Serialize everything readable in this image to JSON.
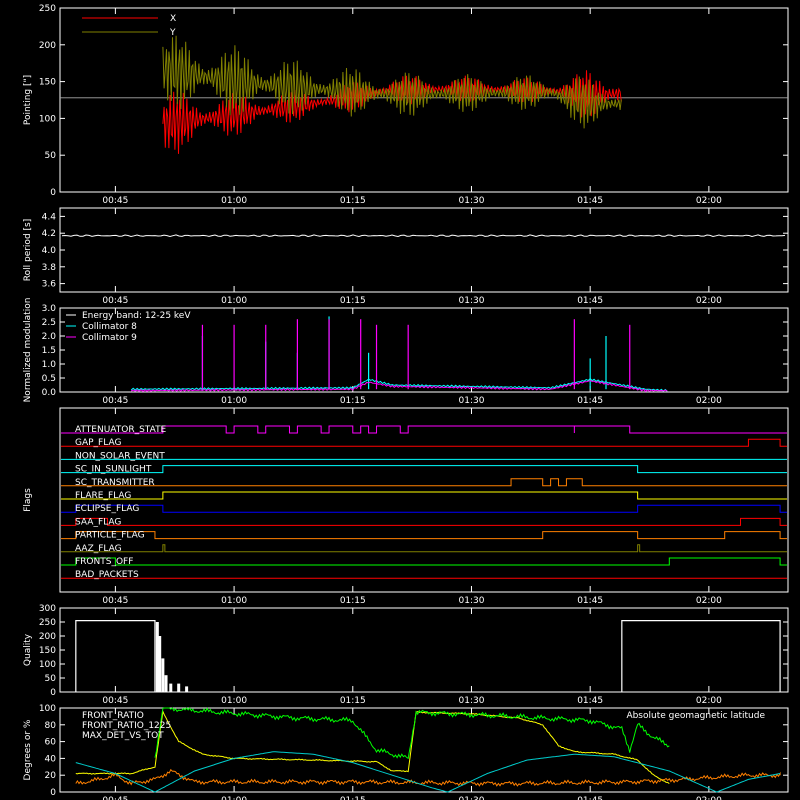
{
  "chart_data": [
    {
      "type": "line",
      "ylabel": "Pointing [\"]",
      "ylim": [
        0,
        250
      ],
      "yticks": [
        "0",
        "50",
        "100",
        "150",
        "200",
        "250"
      ],
      "xticks": [
        "00:45",
        "01:00",
        "01:15",
        "01:30",
        "01:45",
        "02:00"
      ],
      "series": [
        {
          "name": "X",
          "color": "#ff0000"
        },
        {
          "name": "Y",
          "color": "#808000"
        }
      ],
      "reference_level": 128,
      "data_window": [
        "00:51",
        "01:49"
      ],
      "oscillation_period_s": 4.2,
      "envelope": {
        "t": [
          "00:51",
          "01:00",
          "01:10",
          "01:20",
          "01:30",
          "01:40",
          "01:42",
          "01:45",
          "01:49"
        ],
        "x_min": [
          45,
          75,
          100,
          118,
          122,
          120,
          112,
          95,
          100
        ],
        "x_max": [
          140,
          135,
          140,
          160,
          158,
          155,
          160,
          168,
          168
        ],
        "y_min": [
          115,
          100,
          105,
          100,
          108,
          112,
          90,
          85,
          95
        ],
        "y_max": [
          218,
          200,
          175,
          165,
          160,
          160,
          165,
          155,
          145
        ]
      }
    },
    {
      "type": "line",
      "ylabel": "Roll period [s]",
      "ylim": [
        3.5,
        4.5
      ],
      "yticks": [
        "3.6",
        "3.8",
        "4.0",
        "4.2",
        "4.4"
      ],
      "xticks": [
        "00:45",
        "01:00",
        "01:15",
        "01:30",
        "01:45",
        "02:00"
      ],
      "series": [
        {
          "name": "",
          "color": "#ffffff",
          "value": 4.17
        }
      ]
    },
    {
      "type": "line",
      "ylabel": "Normalized modulation",
      "ylim": [
        0,
        3
      ],
      "yticks": [
        "0.0",
        "0.5",
        "1.0",
        "1.5",
        "2.0",
        "2.5",
        "3.0"
      ],
      "xticks": [
        "00:45",
        "01:00",
        "01:15",
        "01:30",
        "01:45",
        "02:00"
      ],
      "legend": [
        "Energy band: 12-25 keV",
        "Collimator 8",
        "Collimator 9"
      ],
      "series": [
        {
          "name": "Collimator 8",
          "color": "#00ffff",
          "baseline": [
            [
              "00:47",
              0.1
            ],
            [
              "01:15",
              0.15
            ],
            [
              "01:17",
              0.45
            ],
            [
              "01:20",
              0.25
            ],
            [
              "01:30",
              0.2
            ],
            [
              "01:40",
              0.15
            ],
            [
              "01:45",
              0.45
            ],
            [
              "01:52",
              0.1
            ],
            [
              "01:55",
              0.05
            ]
          ],
          "spikes": [
            [
              "00:56",
              2.0
            ],
            [
              "01:04",
              1.8
            ],
            [
              "01:08",
              1.4
            ],
            [
              "01:12",
              2.7
            ],
            [
              "01:17",
              1.4
            ],
            [
              "01:45",
              1.2
            ],
            [
              "01:47",
              2.0
            ]
          ]
        },
        {
          "name": "Collimator 9",
          "color": "#ff00ff",
          "baseline": [
            [
              "00:47",
              0.05
            ],
            [
              "01:15",
              0.1
            ],
            [
              "01:17",
              0.35
            ],
            [
              "01:20",
              0.2
            ],
            [
              "01:30",
              0.15
            ],
            [
              "01:40",
              0.1
            ],
            [
              "01:45",
              0.4
            ],
            [
              "01:52",
              0.05
            ],
            [
              "01:55",
              0.05
            ]
          ],
          "spikes": [
            [
              "00:56",
              2.4
            ],
            [
              "01:00",
              2.4
            ],
            [
              "01:04",
              2.4
            ],
            [
              "01:08",
              2.6
            ],
            [
              "01:12",
              2.6
            ],
            [
              "01:16",
              2.6
            ],
            [
              "01:18",
              2.4
            ],
            [
              "01:22",
              2.4
            ],
            [
              "01:43",
              2.6
            ],
            [
              "01:50",
              2.4
            ]
          ]
        }
      ]
    },
    {
      "type": "line",
      "ylabel": "Flags",
      "xticks": [
        "00:45",
        "01:00",
        "01:15",
        "01:30",
        "01:45",
        "02:00"
      ],
      "series": [
        {
          "name": "ATTENUATOR_STATE",
          "color": "#ff00ff",
          "on": [
            [
              "00:51",
              "00:59"
            ],
            [
              "01:00",
              "01:03"
            ],
            [
              "01:04",
              "01:07"
            ],
            [
              "01:08",
              "01:11"
            ],
            [
              "01:12",
              "01:15"
            ],
            [
              "01:16",
              "01:17"
            ],
            [
              "01:18",
              "01:21"
            ],
            [
              "01:22",
              "01:43"
            ],
            [
              "01:43",
              "01:50"
            ]
          ]
        },
        {
          "name": "GAP_FLAG",
          "color": "#ff0000",
          "on": [
            [
              "02:05",
              "02:09"
            ]
          ]
        },
        {
          "name": "NON_SOLAR_EVENT",
          "color": "#00ffff",
          "on": []
        },
        {
          "name": "SC_IN_SUNLIGHT",
          "color": "#00ffff",
          "on": [
            [
              "00:51",
              "01:51"
            ]
          ]
        },
        {
          "name": "SC_TRANSMITTER",
          "color": "#ff8000",
          "on": [
            [
              "01:35",
              "01:39"
            ],
            [
              "01:40",
              "01:41"
            ],
            [
              "01:42",
              "01:44"
            ]
          ]
        },
        {
          "name": "FLARE_FLAG",
          "color": "#ffff00",
          "on": [
            [
              "00:51",
              "01:51"
            ]
          ]
        },
        {
          "name": "ECLIPSE_FLAG",
          "color": "#0000ff",
          "on": [
            [
              "00:40",
              "00:51"
            ],
            [
              "01:51",
              "02:09"
            ]
          ]
        },
        {
          "name": "SAA_FLAG",
          "color": "#ff0000",
          "on": [
            [
              "00:40",
              "00:44"
            ],
            [
              "02:04",
              "02:09"
            ]
          ]
        },
        {
          "name": "PARTICLE_FLAG",
          "color": "#ff8000",
          "on": [
            [
              "00:40",
              "00:50"
            ],
            [
              "01:39",
              "01:51"
            ],
            [
              "02:02",
              "02:09"
            ]
          ]
        },
        {
          "name": "AAZ_FLAG",
          "color": "#808000",
          "on": [
            [
              "00:51",
              "00:51"
            ],
            [
              "01:51",
              "01:51"
            ]
          ]
        },
        {
          "name": "FRONTS_OFF",
          "color": "#00ff00",
          "on": [
            [
              "00:40",
              "00:45"
            ],
            [
              "01:55",
              "02:09"
            ]
          ]
        },
        {
          "name": "BAD_PACKETS",
          "color": "#ff0000",
          "on": []
        }
      ]
    },
    {
      "type": "bar",
      "ylabel": "Quality",
      "ylim": [
        0,
        300
      ],
      "yticks": [
        "0",
        "50",
        "100",
        "150",
        "200",
        "250",
        "300"
      ],
      "xticks": [
        "00:45",
        "01:00",
        "01:15",
        "01:30",
        "01:45",
        "02:00"
      ],
      "segments": [
        {
          "from": "00:40",
          "to": "00:50",
          "value": 255
        },
        {
          "from": "01:49",
          "to": "02:09",
          "value": 255
        }
      ],
      "bars": [
        [
          "00:50.3",
          250
        ],
        [
          "00:50.6",
          200
        ],
        [
          "00:51",
          120
        ],
        [
          "00:51.4",
          60
        ],
        [
          "00:52",
          30
        ],
        [
          "00:53",
          30
        ],
        [
          "00:54",
          20
        ]
      ]
    },
    {
      "type": "line",
      "ylabel": "Degrees or %",
      "ylim": [
        0,
        100
      ],
      "yticks": [
        "0",
        "20",
        "40",
        "60",
        "80",
        "100"
      ],
      "xticks": [
        "00:45",
        "01:00",
        "01:15",
        "01:30",
        "01:45",
        "02:00"
      ],
      "legend": [
        "FRONT_RATIO",
        "FRONT_RATIO_1225",
        "MAX_DET_VS_TOT",
        "Absolute geomagnetic latitude"
      ],
      "series": [
        {
          "name": "FRONT_RATIO",
          "color": "#ffff00",
          "points": [
            [
              "00:40",
              22
            ],
            [
              "00:47",
              22
            ],
            [
              "00:50",
              30
            ],
            [
              "00:51",
              95
            ],
            [
              "00:53",
              60
            ],
            [
              "00:56",
              45
            ],
            [
              "01:00",
              40
            ],
            [
              "01:10",
              38
            ],
            [
              "01:18",
              36
            ],
            [
              "01:20",
              25
            ],
            [
              "01:22",
              25
            ],
            [
              "01:23",
              95
            ],
            [
              "01:30",
              93
            ],
            [
              "01:36",
              88
            ],
            [
              "01:39",
              80
            ],
            [
              "01:41",
              55
            ],
            [
              "01:43",
              48
            ],
            [
              "01:48",
              45
            ],
            [
              "01:51",
              38
            ],
            [
              "01:53",
              20
            ],
            [
              "01:55",
              10
            ]
          ]
        },
        {
          "name": "FRONT_RATIO_1225",
          "color": "#00ff00",
          "points": [
            [
              "00:50",
              40
            ],
            [
              "00:51",
              100
            ],
            [
              "00:58",
              95
            ],
            [
              "01:08",
              88
            ],
            [
              "01:15",
              85
            ],
            [
              "01:18",
              50
            ],
            [
              "01:22",
              40
            ],
            [
              "01:23",
              95
            ],
            [
              "01:35",
              90
            ],
            [
              "01:45",
              85
            ],
            [
              "01:49",
              75
            ],
            [
              "01:50",
              50
            ],
            [
              "01:51",
              80
            ],
            [
              "01:53",
              65
            ],
            [
              "01:55",
              55
            ]
          ]
        },
        {
          "name": "MAX_DET_VS_TOT",
          "color": "#ff8000",
          "points": [
            [
              "00:40",
              10
            ],
            [
              "00:43",
              15
            ],
            [
              "00:45",
              20
            ],
            [
              "00:47",
              10
            ],
            [
              "00:50",
              15
            ],
            [
              "00:52",
              25
            ],
            [
              "00:55",
              12
            ],
            [
              "01:15",
              12
            ],
            [
              "01:35",
              10
            ],
            [
              "01:50",
              12
            ],
            [
              "01:55",
              14
            ],
            [
              "02:05",
              20
            ],
            [
              "02:09",
              20
            ]
          ]
        },
        {
          "name": "Absolute geomagnetic latitude",
          "color": "#00cccc",
          "points": [
            [
              "00:40",
              35
            ],
            [
              "00:45",
              22
            ],
            [
              "00:50",
              0
            ],
            [
              "00:55",
              25
            ],
            [
              "01:00",
              40
            ],
            [
              "01:05",
              48
            ],
            [
              "01:10",
              45
            ],
            [
              "01:15",
              35
            ],
            [
              "01:20",
              20
            ],
            [
              "01:25",
              5
            ],
            [
              "01:27",
              0
            ],
            [
              "01:32",
              22
            ],
            [
              "01:37",
              38
            ],
            [
              "01:43",
              45
            ],
            [
              "01:48",
              42
            ],
            [
              "01:55",
              25
            ],
            [
              "02:01",
              0
            ],
            [
              "02:05",
              15
            ],
            [
              "02:09",
              22
            ]
          ]
        }
      ]
    }
  ]
}
